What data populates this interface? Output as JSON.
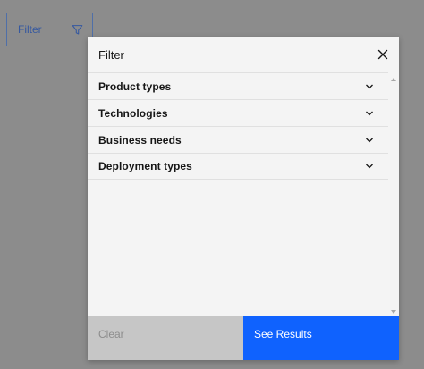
{
  "trigger": {
    "label": "Filter",
    "icon": "funnel-icon"
  },
  "modal": {
    "title": "Filter",
    "close_icon": "close-icon",
    "sections": [
      {
        "label": "Product types",
        "icon": "chevron-down-icon"
      },
      {
        "label": "Technologies",
        "icon": "chevron-down-icon"
      },
      {
        "label": "Business needs",
        "icon": "chevron-down-icon"
      },
      {
        "label": "Deployment types",
        "icon": "chevron-down-icon"
      }
    ],
    "footer": {
      "clear_label": "Clear",
      "results_label": "See Results"
    }
  },
  "colors": {
    "overlay": "#8c8c8c",
    "trigger_border": "#4f6fa8",
    "trigger_text": "#3558a0",
    "modal_bg": "#f4f4f4",
    "clear_bg": "#c6c6c6",
    "clear_text": "#8d8d8d",
    "primary": "#0f62fe"
  }
}
